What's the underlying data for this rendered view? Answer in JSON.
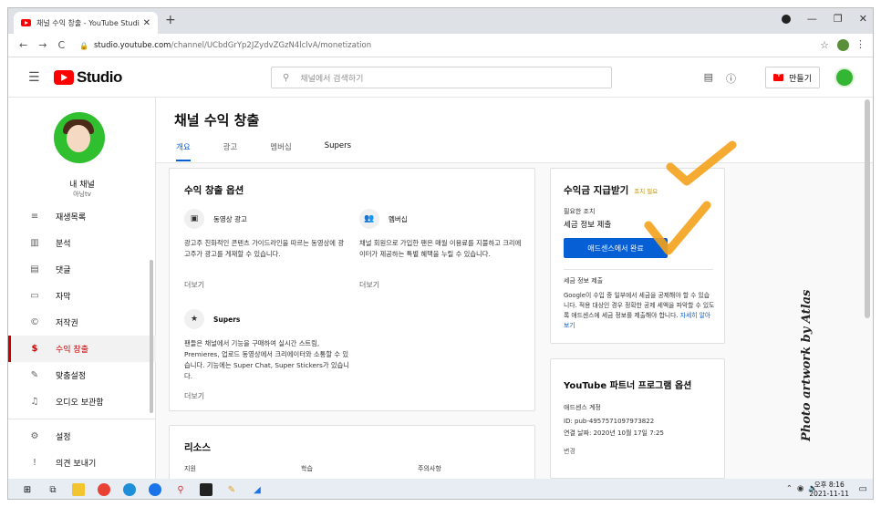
{
  "browser": {
    "tab_title": "채널 수익 창출 - YouTube Studio",
    "url_host": "studio.youtube.com",
    "url_path": "/channel/UCbdGrYp2JZydvZGzN4lclvA/monetization"
  },
  "header": {
    "logo_text": "Studio",
    "search_placeholder": "채널에서 검색하기",
    "create_label": "만들기"
  },
  "sidebar": {
    "channel_label": "내 채널",
    "channel_handle": "아닝tv",
    "items": [
      {
        "label": "재생목록",
        "icon": "playlist-icon"
      },
      {
        "label": "분석",
        "icon": "analytics-icon"
      },
      {
        "label": "댓글",
        "icon": "comments-icon"
      },
      {
        "label": "자막",
        "icon": "subtitles-icon"
      },
      {
        "label": "저작권",
        "icon": "copyright-icon"
      },
      {
        "label": "수익 창출",
        "icon": "dollar-icon"
      },
      {
        "label": "맞춤설정",
        "icon": "customize-icon"
      },
      {
        "label": "오디오 보관함",
        "icon": "audio-library-icon"
      },
      {
        "label": "설정",
        "icon": "settings-icon"
      },
      {
        "label": "의견 보내기",
        "icon": "feedback-icon"
      }
    ]
  },
  "page": {
    "title": "채널 수익 창출",
    "tabs": [
      "개요",
      "광고",
      "멤버십",
      "Supers"
    ]
  },
  "options_card": {
    "title": "수익 창출 옵션",
    "ads_title": "동영상 광고",
    "ads_desc": "광고주 친화적인 콘텐츠 가이드라인을 따르는 동영상에 광고주가 광고를 게재할 수 있습니다.",
    "ads_more": "더보기",
    "members_title": "멤버십",
    "members_desc": "채널 회원으로 가입한 팬은 매월 이용료를 지불하고 크리에이터가 제공하는 특별 혜택을 누릴 수 있습니다.",
    "members_more": "더보기",
    "supers_title": "Supers",
    "supers_desc": "팬들은 채널에서 기능을 구매하여 실시간 스트림, Premieres, 업로드 동영상에서 크리에이터와 소통할 수 있습니다. 기능에는 Super Chat, Super Stickers가 있습니다.",
    "supers_more": "더보기"
  },
  "resources_card": {
    "title": "리소스",
    "cols": [
      "지원",
      "학습",
      "주의사항"
    ]
  },
  "payout_card": {
    "title": "수익금 지급받기",
    "badge": "조치 필요",
    "needed_label": "필요한 조치",
    "needed_value": "세금 정보 제출",
    "button_label": "애드센스에서 완료",
    "tax_title": "세금 정보 제출",
    "tax_desc": "Google이 수입 중 일부에서 세금을 공제해야 할 수 있습니다. 적용 대상인 경우 정확한 공제 세액을 파악할 수 있도록 애드센스에 세금 정보를 제출해야 합니다.",
    "tax_link": "자세히 알아보기"
  },
  "partner_card": {
    "title": "YouTube 파트너 프로그램 옵션",
    "adsense_label": "애드센스 계정",
    "adsense_id": "ID: pub-4957571097973822",
    "linked_date": "연결 날짜: 2020년 10월 17일 7:25",
    "change_label": "변경"
  },
  "watermark": "Photo artwork by Atlas",
  "taskbar": {
    "time": "오후 8:16",
    "date": "2021-11-11"
  },
  "colors": {
    "accent_blue": "#065fd4",
    "active_red": "#cc0000",
    "check_orange": "#f4a21b"
  }
}
